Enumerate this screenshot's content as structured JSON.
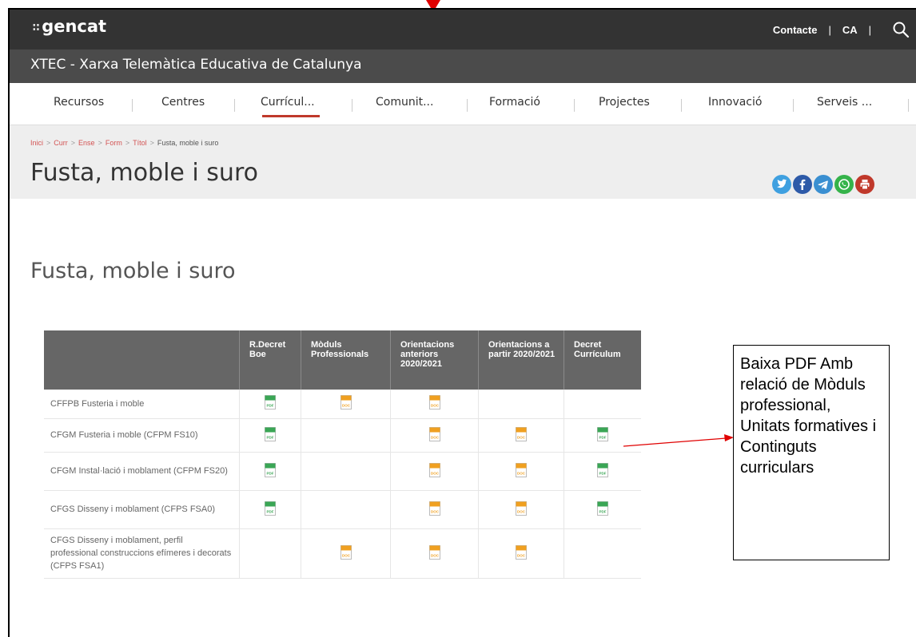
{
  "header": {
    "logo": "gencat",
    "logo_prefix": "::",
    "contact": "Contacte",
    "lang": "CA",
    "sep": "|"
  },
  "site": {
    "name": "XTEC - Xarxa Telemàtica Educativa de Catalunya"
  },
  "nav": {
    "items": [
      {
        "label": "Recursos"
      },
      {
        "label": "Centres"
      },
      {
        "label": "Currícul..."
      },
      {
        "label": "Comunit..."
      },
      {
        "label": "Formació"
      },
      {
        "label": "Projectes"
      },
      {
        "label": "Innovació"
      },
      {
        "label": "Serveis ..."
      }
    ],
    "active": "Currícul..."
  },
  "breadcrumb": {
    "items": [
      "Inici",
      "Curr",
      "Ense",
      "Form",
      "Títol"
    ],
    "sep": ">",
    "current": "Fusta, moble i suro"
  },
  "page": {
    "title": "Fusta, moble i suro",
    "heading": "Fusta, moble i suro"
  },
  "share": [
    {
      "icon": "twitter-icon",
      "color": "#3fa0e0"
    },
    {
      "icon": "facebook-icon",
      "color": "#2d5aa8"
    },
    {
      "icon": "telegram-icon",
      "color": "#3a8fd1"
    },
    {
      "icon": "whatsapp-icon",
      "color": "#35b34a"
    },
    {
      "icon": "print-icon",
      "color": "#c0392b"
    }
  ],
  "table": {
    "headers": [
      "",
      "R.Decret Boe",
      "Mòduls Professionals",
      "Orientacions anteriors 2020/2021",
      "Orientacions a partir 2020/2021",
      "Decret Currículum"
    ],
    "rows": [
      {
        "name": "CFFPB Fusteria i moble",
        "cells": [
          "pdf",
          "doc",
          "doc",
          "",
          ""
        ]
      },
      {
        "name": "CFGM Fusteria i moble (CFPM FS10)",
        "cells": [
          "pdf",
          "",
          "doc",
          "doc",
          "pdf"
        ]
      },
      {
        "name": "CFGM Instal·lació i moblament (CFPM FS20)",
        "cells": [
          "pdf",
          "",
          "doc",
          "doc",
          "pdf"
        ]
      },
      {
        "name": "CFGS Disseny i moblament (CFPS FSA0)",
        "cells": [
          "pdf",
          "",
          "doc",
          "doc",
          "pdf"
        ]
      },
      {
        "name": "CFGS Disseny i moblament, perfil professional construccions efímeres i decorats (CFPS FSA1)",
        "cells": [
          "",
          "doc",
          "doc",
          "doc",
          ""
        ]
      }
    ],
    "icon_labels": {
      "pdf": "PDF",
      "doc": "DOC"
    }
  },
  "annotation": {
    "text": "Baixa PDF Amb relació de Mòduls professional, Unitats formatives i Continguts curriculars"
  },
  "colors": {
    "topbar": "#333333",
    "subbar": "#4b4b4b",
    "accent": "#c0392b",
    "pdf_icon": "#3aa655",
    "doc_icon": "#f0a020",
    "annotation_arrow": "#e00000"
  }
}
